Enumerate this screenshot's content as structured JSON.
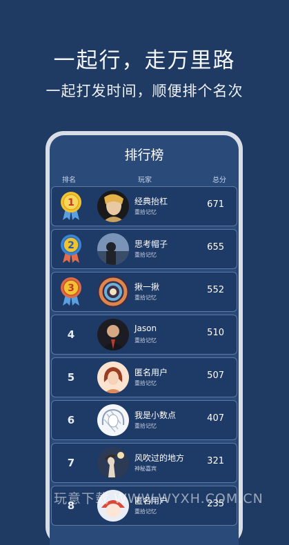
{
  "hero": {
    "title": "一起行，走万里路",
    "subtitle": "一起打发时间，顺便排个名次"
  },
  "leaderboard": {
    "title": "排行榜",
    "columns": {
      "rank": "排名",
      "player": "玩家",
      "score": "总分"
    },
    "rows": [
      {
        "rank": "1",
        "medal": "gold",
        "name": "经典抬杠",
        "subtitle": "重拾记忆",
        "score": "671"
      },
      {
        "rank": "2",
        "medal": "blue",
        "name": "思考帽子",
        "subtitle": "重拾记忆",
        "score": "655"
      },
      {
        "rank": "3",
        "medal": "red",
        "name": "揪一揪",
        "subtitle": "重拾记忆",
        "score": "552"
      },
      {
        "rank": "4",
        "name": "Jason",
        "subtitle": "重拾记忆",
        "score": "510"
      },
      {
        "rank": "5",
        "name": "匿名用户",
        "subtitle": "重拾记忆",
        "score": "507"
      },
      {
        "rank": "6",
        "name": "我是小数点",
        "subtitle": "重拾记忆",
        "score": "407"
      },
      {
        "rank": "7",
        "name": "风吹过的地方",
        "subtitle": "神秘嘉宾",
        "score": "321"
      },
      {
        "rank": "8",
        "name": "匿名用户",
        "subtitle": "重拾记忆",
        "score": "235"
      }
    ]
  },
  "watermark": "玩意下载 WWW.WYXH.COM.CN",
  "colors": {
    "background": "#1f3a63",
    "row": "#1e3a66",
    "gold": "#f2c230",
    "silver_blue": "#3a86d4",
    "bronze_red": "#e06a45"
  }
}
